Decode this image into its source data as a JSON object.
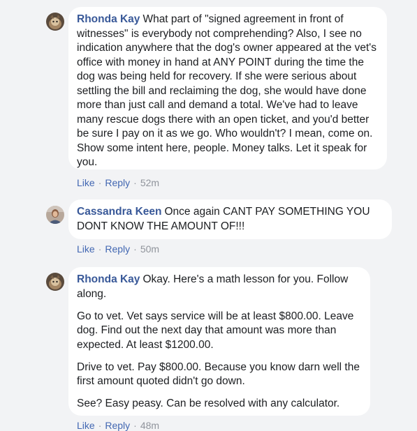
{
  "comments": [
    {
      "author": "Rhonda Kay",
      "paragraphs": [
        "What part of \"signed agreement in front of witnesses\" is everybody not comprehending? Also, I see no indication anywhere that the dog's owner appeared at the vet's office with money in hand at ANY POINT during the time the dog was being held for recovery. If she were serious about settling the bill and reclaiming the dog, she would have done more than just call and demand a total. We've had to leave many rescue dogs there with an open ticket, and you'd better be sure I pay on it as we go. Who wouldn't? I mean, come on. Show some intent here, people. Money talks. Let it speak for you."
      ],
      "like": "Like",
      "reply": "Reply",
      "time": "52m"
    },
    {
      "author": "Cassandra Keen",
      "paragraphs": [
        "Once again CANT PAY SOMETHING YOU DONT KNOW THE AMOUNT OF!!!"
      ],
      "like": "Like",
      "reply": "Reply",
      "time": "50m"
    },
    {
      "author": "Rhonda Kay",
      "paragraphs": [
        "Okay. Here's a math lesson for you. Follow along.",
        "Go to vet. Vet says service will be at least $800.00. Leave dog. Find out the next day that amount was more than expected. At least $1200.00.",
        "Drive to vet. Pay $800.00. Because you know darn well the first amount quoted didn't go down.",
        "See? Easy peasy. Can be resolved with any calculator."
      ],
      "like": "Like",
      "reply": "Reply",
      "time": "48m"
    }
  ],
  "separator": "·",
  "colors": {
    "background": "#f2f3f5",
    "bubble": "#ffffff",
    "author": "#385898",
    "link": "#4267b2",
    "meta": "#90949c"
  }
}
